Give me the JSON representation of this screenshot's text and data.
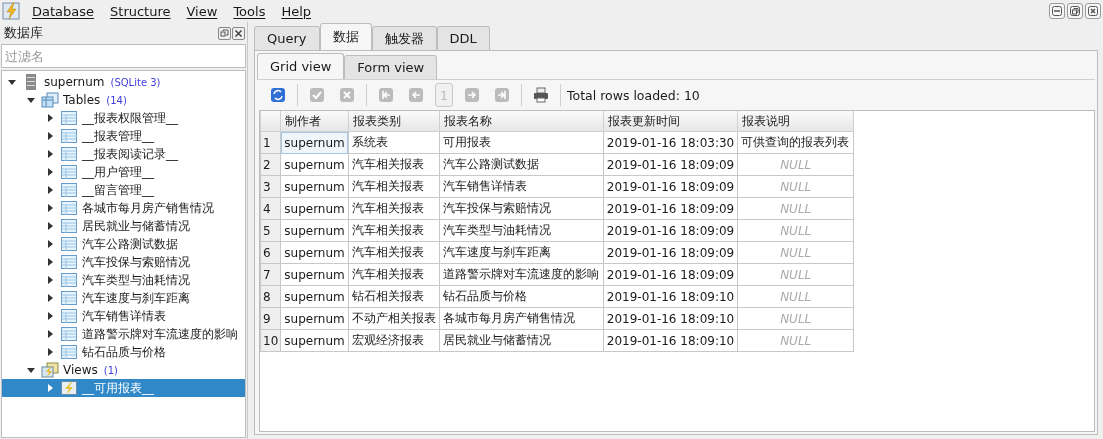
{
  "menu": [
    "Database",
    "Structure",
    "View",
    "Tools",
    "Help"
  ],
  "sidebar": {
    "title": "数据库",
    "filter": {
      "placeholder": "过滤名"
    },
    "tree": [
      {
        "label": "supernum",
        "kind": "database",
        "badge": "(SQLite 3)",
        "expanded": true,
        "selected": false,
        "children": [
          {
            "label": "Tables",
            "kind": "folder-tables",
            "badge": "(14)",
            "expanded": true,
            "selected": false,
            "children": [
              {
                "label": "__报表权限管理__",
                "kind": "table",
                "expanded": false,
                "selected": false
              },
              {
                "label": "__报表管理__",
                "kind": "table",
                "expanded": false,
                "selected": false
              },
              {
                "label": "__报表阅读记录__",
                "kind": "table",
                "expanded": false,
                "selected": false
              },
              {
                "label": "__用户管理__",
                "kind": "table",
                "expanded": false,
                "selected": false
              },
              {
                "label": "__留言管理__",
                "kind": "table",
                "expanded": false,
                "selected": false
              },
              {
                "label": "各城市每月房产销售情况",
                "kind": "table",
                "expanded": false,
                "selected": false
              },
              {
                "label": "居民就业与储蓄情况",
                "kind": "table",
                "expanded": false,
                "selected": false
              },
              {
                "label": "汽车公路测试数据",
                "kind": "table",
                "expanded": false,
                "selected": false
              },
              {
                "label": "汽车投保与索赔情况",
                "kind": "table",
                "expanded": false,
                "selected": false
              },
              {
                "label": "汽车类型与油耗情况",
                "kind": "table",
                "expanded": false,
                "selected": false
              },
              {
                "label": "汽车速度与刹车距离",
                "kind": "table",
                "expanded": false,
                "selected": false
              },
              {
                "label": "汽车销售详情表",
                "kind": "table",
                "expanded": false,
                "selected": false
              },
              {
                "label": "道路警示牌对车流速度的影响",
                "kind": "table",
                "expanded": false,
                "selected": false
              },
              {
                "label": "钻石品质与价格",
                "kind": "table",
                "expanded": false,
                "selected": false
              }
            ]
          },
          {
            "label": "Views",
            "kind": "folder-views",
            "badge": "(1)",
            "expanded": true,
            "selected": false,
            "children": [
              {
                "label": "__可用报表__",
                "kind": "view",
                "expanded": false,
                "selected": true
              }
            ]
          }
        ]
      }
    ]
  },
  "tabs": [
    {
      "label": "Query",
      "selected": false
    },
    {
      "label": "数据",
      "selected": true
    },
    {
      "label": "触发器",
      "selected": false
    },
    {
      "label": "DDL",
      "selected": false
    }
  ],
  "subtabs": [
    {
      "label": "Grid view",
      "selected": true
    },
    {
      "label": "Form view",
      "selected": false
    }
  ],
  "toolbar": {
    "tools": [
      {
        "kind": "refresh",
        "disabled": false
      },
      {
        "kind": "sep"
      },
      {
        "kind": "commit",
        "disabled": true
      },
      {
        "kind": "rollback",
        "disabled": true
      },
      {
        "kind": "sep"
      },
      {
        "kind": "first",
        "disabled": true
      },
      {
        "kind": "prev",
        "disabled": true
      },
      {
        "kind": "page",
        "label": "1",
        "disabled": true
      },
      {
        "kind": "next",
        "disabled": true
      },
      {
        "kind": "last",
        "disabled": true
      },
      {
        "kind": "sep"
      },
      {
        "kind": "print",
        "disabled": false
      },
      {
        "kind": "sep"
      }
    ],
    "status": "Total rows loaded: 10"
  },
  "table": {
    "columns": [
      "制作者",
      "报表类别",
      "报表名称",
      "报表更新时间",
      "报表说明"
    ],
    "rows": [
      {
        "number": "1",
        "cells": [
          "supernum",
          "系统表",
          "可用报表",
          "2019-01-16 18:03:30",
          "可供查询的报表列表"
        ],
        "nulls": [
          false,
          false,
          false,
          false,
          false
        ],
        "current": [
          true,
          false,
          false,
          false,
          false
        ]
      },
      {
        "number": "2",
        "cells": [
          "supernum",
          "汽车相关报表",
          "汽车公路测试数据",
          "2019-01-16 18:09:09",
          "NULL"
        ],
        "nulls": [
          false,
          false,
          false,
          false,
          true
        ],
        "current": [
          false,
          false,
          false,
          false,
          false
        ]
      },
      {
        "number": "3",
        "cells": [
          "supernum",
          "汽车相关报表",
          "汽车销售详情表",
          "2019-01-16 18:09:09",
          "NULL"
        ],
        "nulls": [
          false,
          false,
          false,
          false,
          true
        ],
        "current": [
          false,
          false,
          false,
          false,
          false
        ]
      },
      {
        "number": "4",
        "cells": [
          "supernum",
          "汽车相关报表",
          "汽车投保与索赔情况",
          "2019-01-16 18:09:09",
          "NULL"
        ],
        "nulls": [
          false,
          false,
          false,
          false,
          true
        ],
        "current": [
          false,
          false,
          false,
          false,
          false
        ]
      },
      {
        "number": "5",
        "cells": [
          "supernum",
          "汽车相关报表",
          "汽车类型与油耗情况",
          "2019-01-16 18:09:09",
          "NULL"
        ],
        "nulls": [
          false,
          false,
          false,
          false,
          true
        ],
        "current": [
          false,
          false,
          false,
          false,
          false
        ]
      },
      {
        "number": "6",
        "cells": [
          "supernum",
          "汽车相关报表",
          "汽车速度与刹车距离",
          "2019-01-16 18:09:09",
          "NULL"
        ],
        "nulls": [
          false,
          false,
          false,
          false,
          true
        ],
        "current": [
          false,
          false,
          false,
          false,
          false
        ]
      },
      {
        "number": "7",
        "cells": [
          "supernum",
          "汽车相关报表",
          "道路警示牌对车流速度的影响",
          "2019-01-16 18:09:09",
          "NULL"
        ],
        "nulls": [
          false,
          false,
          false,
          false,
          true
        ],
        "current": [
          false,
          false,
          false,
          false,
          false
        ]
      },
      {
        "number": "8",
        "cells": [
          "supernum",
          "钻石相关报表",
          "钻石品质与价格",
          "2019-01-16 18:09:10",
          "NULL"
        ],
        "nulls": [
          false,
          false,
          false,
          false,
          true
        ],
        "current": [
          false,
          false,
          false,
          false,
          false
        ]
      },
      {
        "number": "9",
        "cells": [
          "supernum",
          "不动产相关报表",
          "各城市每月房产销售情况",
          "2019-01-16 18:09:10",
          "NULL"
        ],
        "nulls": [
          false,
          false,
          false,
          false,
          true
        ],
        "current": [
          false,
          false,
          false,
          false,
          false
        ]
      },
      {
        "number": "10",
        "cells": [
          "supernum",
          "宏观经济报表",
          "居民就业与储蓄情况",
          "2019-01-16 18:09:10",
          "NULL"
        ],
        "nulls": [
          false,
          false,
          false,
          false,
          true
        ],
        "current": [
          false,
          false,
          false,
          false,
          false
        ]
      }
    ]
  }
}
